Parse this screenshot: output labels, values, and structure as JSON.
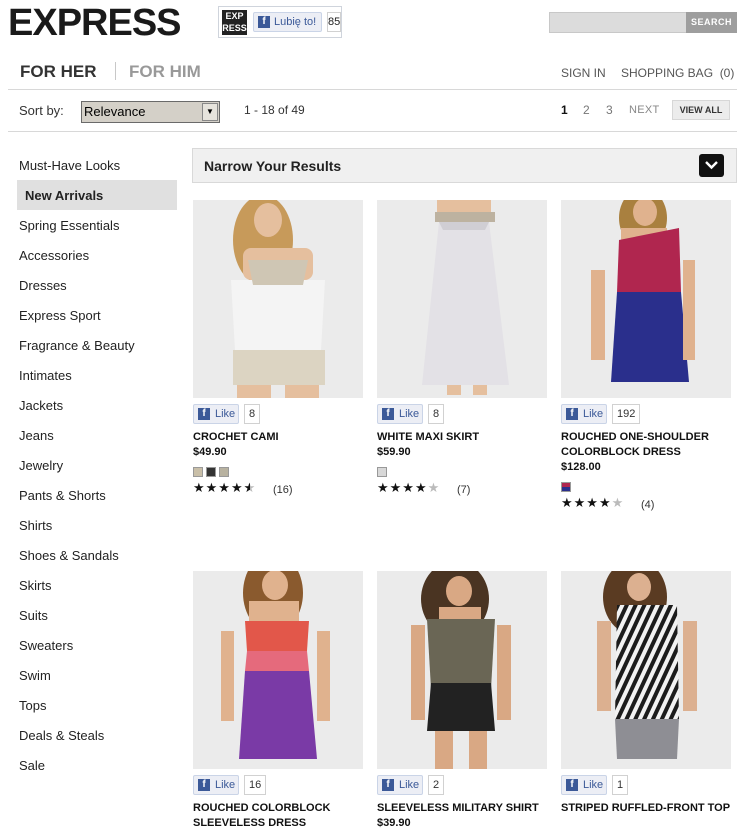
{
  "header": {
    "logo": "EXPRESS",
    "fb_widget": {
      "thumb": "EXP RESS",
      "like_label": "Lubię to!",
      "count": "85"
    },
    "search": {
      "placeholder": "",
      "button": "SEARCH"
    }
  },
  "nav": {
    "for_her": "FOR HER",
    "for_him": "FOR HIM",
    "sign_in": "SIGN IN",
    "shopping_bag": "SHOPPING BAG  (0)"
  },
  "toolbar": {
    "sort_label": "Sort by:",
    "sort_value": "Relevance",
    "range": "1 - 18 of 49",
    "pages": [
      "1",
      "2",
      "3"
    ],
    "next": "NEXT",
    "view_all": "VIEW ALL"
  },
  "sidebar": {
    "items": [
      "Must-Have Looks",
      "New Arrivals",
      "Spring Essentials",
      "Accessories",
      "Dresses",
      "Express Sport",
      "Fragrance & Beauty",
      "Intimates",
      "Jackets",
      "Jeans",
      "Jewelry",
      "Pants & Shorts",
      "Shirts",
      "Shoes & Sandals",
      "Skirts",
      "Suits",
      "Sweaters",
      "Swim",
      "Tops",
      "Deals & Steals",
      "Sale"
    ],
    "active_index": 1
  },
  "narrow": {
    "label": "Narrow Your Results"
  },
  "like_label": "Like",
  "products": [
    {
      "name": "CROCHET CAMI",
      "price": "$49.90",
      "likes": "8",
      "rating": 4.5,
      "reviews": "(16)",
      "swatches": [
        "#c9bfa8",
        "#333333",
        "#b8b2a0"
      ]
    },
    {
      "name": "WHITE MAXI SKIRT",
      "price": "$59.90",
      "likes": "8",
      "rating": 4,
      "reviews": "(7)",
      "swatches": [
        "#d8d8d8"
      ]
    },
    {
      "name": "ROUCHED ONE-SHOULDER COLORBLOCK DRESS",
      "price": "$128.00",
      "likes": "192",
      "rating": 4,
      "reviews": "(4)",
      "swatches": [
        "#b0264f"
      ]
    },
    {
      "name": "ROUCHED COLORBLOCK SLEEVELESS DRESS",
      "price": "",
      "likes": "16",
      "rating": 0,
      "reviews": "",
      "swatches": []
    },
    {
      "name": "SLEEVELESS MILITARY SHIRT",
      "price": "$39.90",
      "likes": "2",
      "rating": 0,
      "reviews": "",
      "swatches": []
    },
    {
      "name": "STRIPED RUFFLED-FRONT TOP",
      "price": "",
      "likes": "1",
      "rating": 0,
      "reviews": "",
      "swatches": []
    }
  ]
}
